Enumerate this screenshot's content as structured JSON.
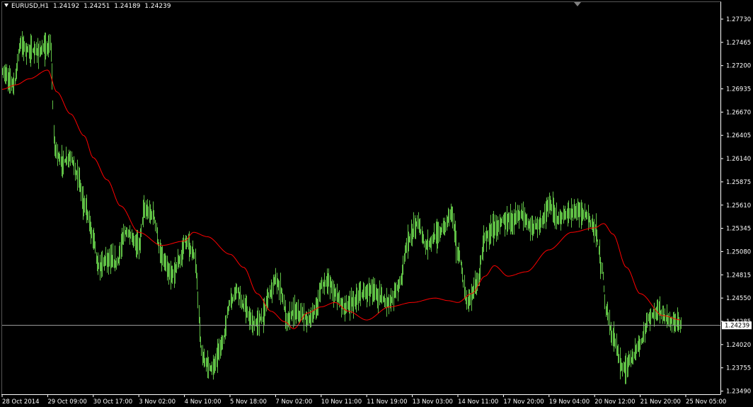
{
  "header": {
    "symbol": "EURUSD,H1",
    "open": "1.24192",
    "high": "1.24251",
    "low": "1.24189",
    "close": "1.24239"
  },
  "colors": {
    "background": "#000000",
    "bars": "#5fbf45",
    "moving_average": "#ff0000",
    "axis": "#ffffff",
    "price_line": "#a0a0a0",
    "scroll_marker": "#808080"
  },
  "chart_data": {
    "type": "line",
    "title": "EURUSD,H1",
    "bar_style": "ohlc-bars",
    "y_axis_side": "right",
    "ylim": [
      1.2349,
      1.2773
    ],
    "grid": false,
    "y_ticks": [
      "1.27730",
      "1.27465",
      "1.27200",
      "1.26935",
      "1.26670",
      "1.26405",
      "1.26140",
      "1.25875",
      "1.25610",
      "1.25345",
      "1.25080",
      "1.24815",
      "1.24550",
      "1.24285",
      "1.24020",
      "1.23755",
      "1.23490"
    ],
    "x_ticks": [
      "28 Oct 2014",
      "29 Oct 09:00",
      "30 Oct 17:00",
      "3 Nov 02:00",
      "4 Nov 10:00",
      "5 Nov 18:00",
      "7 Nov 02:00",
      "10 Nov 11:00",
      "11 Nov 19:00",
      "13 Nov 03:00",
      "14 Nov 11:00",
      "17 Nov 20:00",
      "19 Nov 04:00",
      "20 Nov 12:00",
      "21 Nov 20:00",
      "25 Nov 05:00"
    ],
    "current_price": "1.24239",
    "series": [
      {
        "kind": "price",
        "x_ticks_index": [
          0,
          1,
          2,
          3,
          4,
          5,
          6,
          7,
          8,
          9,
          10,
          11,
          12,
          13,
          14,
          15
        ],
        "knots_x": [
          0,
          0.25,
          0.4,
          0.55,
          0.75,
          1.0,
          1.05,
          1.15,
          1.3,
          1.5,
          1.65,
          1.8,
          2.0,
          2.1,
          2.3,
          2.5,
          2.7,
          3.0,
          3.1,
          3.3,
          3.5,
          3.7,
          3.9,
          4.0,
          4.2,
          4.4,
          4.6,
          4.8,
          5.0,
          5.15,
          5.3,
          5.5,
          5.7,
          5.85,
          6.0,
          6.1,
          6.25,
          6.4,
          6.55,
          6.75,
          6.9,
          7.0,
          7.15,
          7.3,
          7.5,
          7.7,
          7.9,
          8.1,
          8.3,
          8.5,
          8.7,
          8.9,
          9.1,
          9.3,
          9.5,
          9.7,
          9.85,
          10.0,
          10.2,
          10.4,
          10.6,
          10.8,
          11.0,
          11.2,
          11.4,
          11.6,
          11.8,
          12.0,
          12.2,
          12.4,
          12.6,
          12.8,
          13.0,
          13.15,
          13.25,
          13.4,
          13.6,
          13.8,
          14.0,
          14.2,
          14.4,
          14.6,
          14.9
        ],
        "knots_y": [
          1.2712,
          1.27,
          1.2745,
          1.2738,
          1.2736,
          1.274,
          1.2745,
          1.2625,
          1.261,
          1.2615,
          1.2595,
          1.256,
          1.2525,
          1.249,
          1.25,
          1.2495,
          1.253,
          1.2515,
          1.2555,
          1.255,
          1.25,
          1.248,
          1.2498,
          1.252,
          1.2505,
          1.2385,
          1.2375,
          1.24,
          1.245,
          1.2465,
          1.2445,
          1.2425,
          1.2432,
          1.246,
          1.2475,
          1.2465,
          1.243,
          1.244,
          1.2435,
          1.243,
          1.2445,
          1.247,
          1.2475,
          1.246,
          1.2445,
          1.245,
          1.246,
          1.2465,
          1.2455,
          1.245,
          1.247,
          1.252,
          1.254,
          1.2515,
          1.2525,
          1.2535,
          1.2555,
          1.2505,
          1.245,
          1.247,
          1.2525,
          1.2535,
          1.2545,
          1.2545,
          1.255,
          1.2535,
          1.254,
          1.256,
          1.2545,
          1.255,
          1.2555,
          1.255,
          1.2535,
          1.249,
          1.244,
          1.241,
          1.2375,
          1.2385,
          1.2405,
          1.2435,
          1.244,
          1.243,
          1.2425
        ]
      },
      {
        "kind": "moving_average",
        "knots_x": [
          0,
          0.3,
          0.6,
          1.0,
          1.2,
          1.5,
          1.8,
          2.0,
          2.3,
          2.6,
          3.0,
          3.5,
          4.0,
          4.2,
          4.5,
          5.0,
          5.3,
          5.6,
          5.9,
          6.2,
          6.4,
          6.7,
          7.0,
          7.3,
          7.6,
          8.0,
          8.5,
          9.0,
          9.5,
          9.8,
          10.0,
          10.3,
          10.6,
          10.8,
          11.1,
          11.5,
          12.0,
          12.5,
          13.0,
          13.2,
          13.4,
          13.7,
          14.0,
          14.5,
          14.9
        ],
        "knots_y": [
          1.2693,
          1.2698,
          1.2705,
          1.2715,
          1.269,
          1.2665,
          1.264,
          1.2615,
          1.259,
          1.256,
          1.253,
          1.2515,
          1.252,
          1.253,
          1.2525,
          1.2505,
          1.249,
          1.246,
          1.244,
          1.2428,
          1.242,
          1.2438,
          1.2445,
          1.245,
          1.244,
          1.243,
          1.2445,
          1.245,
          1.2455,
          1.2452,
          1.245,
          1.246,
          1.248,
          1.2492,
          1.248,
          1.2485,
          1.251,
          1.253,
          1.2535,
          1.254,
          1.2528,
          1.249,
          1.246,
          1.2435,
          1.243
        ]
      }
    ]
  }
}
